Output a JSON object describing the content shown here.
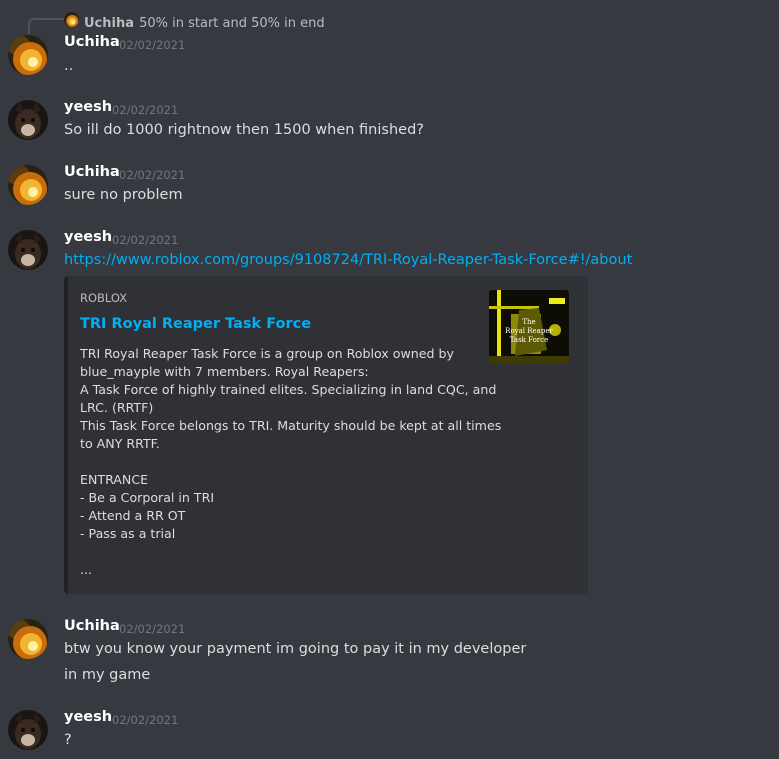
{
  "reply": {
    "author": "Uchiha",
    "text": "50% in start and 50% in end"
  },
  "messages": [
    {
      "author": "Uchiha",
      "timestamp": "02/02/2021",
      "lines": [
        ".."
      ]
    },
    {
      "author": "yeesh",
      "timestamp": "02/02/2021",
      "lines": [
        "So ill do 1000 rightnow then 1500 when finished?"
      ]
    },
    {
      "author": "Uchiha",
      "timestamp": "02/02/2021",
      "lines": [
        "sure no problem"
      ]
    },
    {
      "author": "yeesh",
      "timestamp": "02/02/2021",
      "link": "https://www.roblox.com/groups/9108724/TRI-Royal-Reaper-Task-Force#!/about"
    },
    {
      "author": "Uchiha",
      "timestamp": "02/02/2021",
      "lines": [
        "btw you know your payment im going to pay it in my developer",
        "in my game"
      ]
    },
    {
      "author": "yeesh",
      "timestamp": "02/02/2021",
      "lines": [
        "?"
      ]
    }
  ],
  "embed": {
    "provider": "ROBLOX",
    "title": "TRI Royal Reaper Task Force",
    "description": [
      "TRI Royal Reaper Task Force is a group on Roblox owned by",
      "blue_mayple with 7 members. Royal Reapers:",
      "A Task Force of highly trained elites. Specializing in land CQC, and",
      "LRC. (RRTF)",
      "This Task Force belongs to TRI. Maturity should be kept at all times",
      "to ANY RRTF.",
      "",
      "ENTRANCE",
      "- Be a Corporal in TRI",
      "- Attend a RR OT",
      "- Pass as a trial",
      "",
      "..."
    ],
    "thumbnail_text": [
      "The",
      "Royal Reaper",
      "Task Force"
    ]
  },
  "colors": {
    "background": "#36393f",
    "embed_background": "#2f3136",
    "link": "#00aff4",
    "username": "#ffffff",
    "timestamp": "#72767d"
  }
}
